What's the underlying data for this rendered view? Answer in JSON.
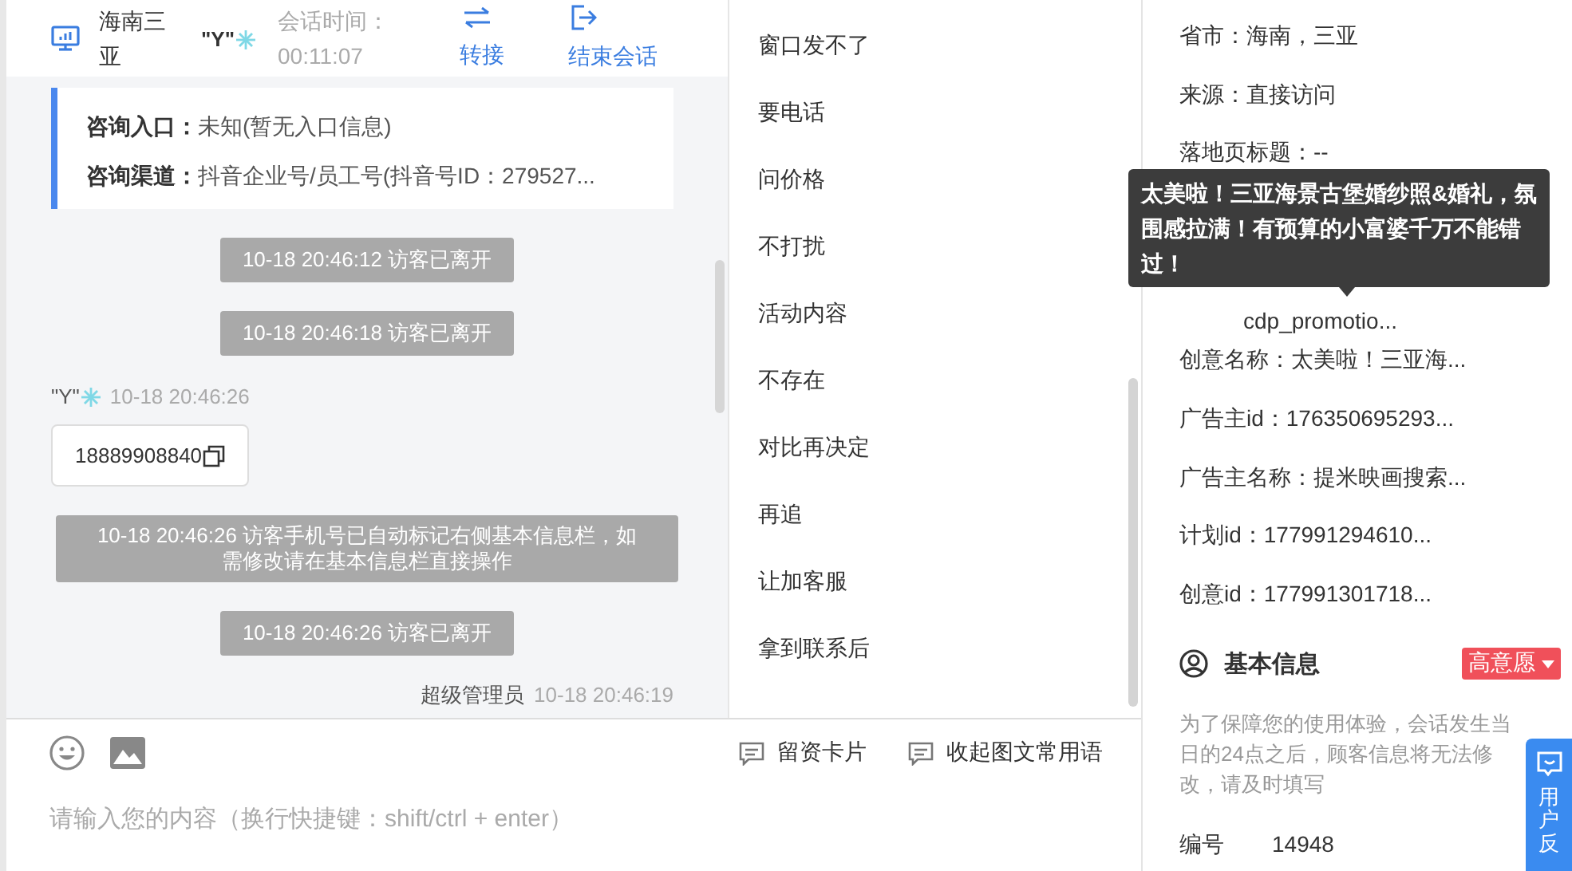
{
  "header": {
    "location": "海南三亚",
    "visitor_name": "\"Y\"",
    "session_time_label": "会话时间：",
    "session_time": "00:11:07",
    "actions": [
      {
        "kind": "transfer",
        "label": "转接"
      },
      {
        "kind": "end",
        "label": "结束会话"
      }
    ]
  },
  "info_card": {
    "rows": [
      {
        "label": "咨询入口：",
        "value": "未知(暂无入口信息)"
      },
      {
        "label": "咨询渠道：",
        "value": "抖音企业号/员工号(抖音号ID：279527..."
      }
    ]
  },
  "messages": [
    {
      "kind": "notice",
      "text": "10-18 20:46:12 访客已离开"
    },
    {
      "kind": "notice",
      "text": "10-18 20:46:18 访客已离开"
    },
    {
      "kind": "visitor",
      "name": "\"Y\"",
      "time": "10-18 20:46:26",
      "text": "18889908840"
    },
    {
      "kind": "notice",
      "text": "10-18 20:46:26 访客手机号已自动标记右侧基本信息栏，如需修改请在基本信息栏直接操作"
    },
    {
      "kind": "notice",
      "text": "10-18 20:46:26 访客已离开"
    },
    {
      "kind": "agent",
      "name": "超级管理员",
      "time": "10-18 20:46:19"
    }
  ],
  "composer": {
    "actions": [
      "留资卡片",
      "收起图文常用语"
    ],
    "placeholder": "请输入您的内容（换行快捷键：shift/ctrl + enter）"
  },
  "quick_replies": [
    "窗口发不了",
    "要电话",
    "问价格",
    "不打扰",
    "活动内容",
    "不存在",
    "对比再决定",
    "再追",
    "让加客服",
    "拿到联系后"
  ],
  "visitor_info": {
    "lines": [
      {
        "kind": "line",
        "text": "省市：海南，三亚"
      },
      {
        "kind": "line",
        "text": "来源：直接访问"
      },
      {
        "kind": "line",
        "text": "落地页标题：--"
      },
      {
        "kind": "partial",
        "text": "cdp_promotio..."
      },
      {
        "kind": "line",
        "text": "创意名称：太美啦！三亚海..."
      },
      {
        "kind": "line",
        "text": "广告主id：176350695293..."
      },
      {
        "kind": "line",
        "text": "广告主名称：提米映画搜索..."
      },
      {
        "kind": "line",
        "text": "计划id：177991294610..."
      },
      {
        "kind": "line",
        "text": "创意id：177991301718..."
      }
    ],
    "tooltip": "太美啦！三亚海景古堡婚纱照&婚礼，氛围感拉满！有预算的小富婆千万不能错过！"
  },
  "basic_info": {
    "title": "基本信息",
    "tag": "高意愿",
    "note": "为了保障您的使用体验，会话发生当日的24点之后，顾客信息将无法修改，请及时填写",
    "fields": [
      {
        "label": "编号",
        "value": "14948"
      }
    ]
  },
  "feedback_button": {
    "label": "用户反"
  }
}
